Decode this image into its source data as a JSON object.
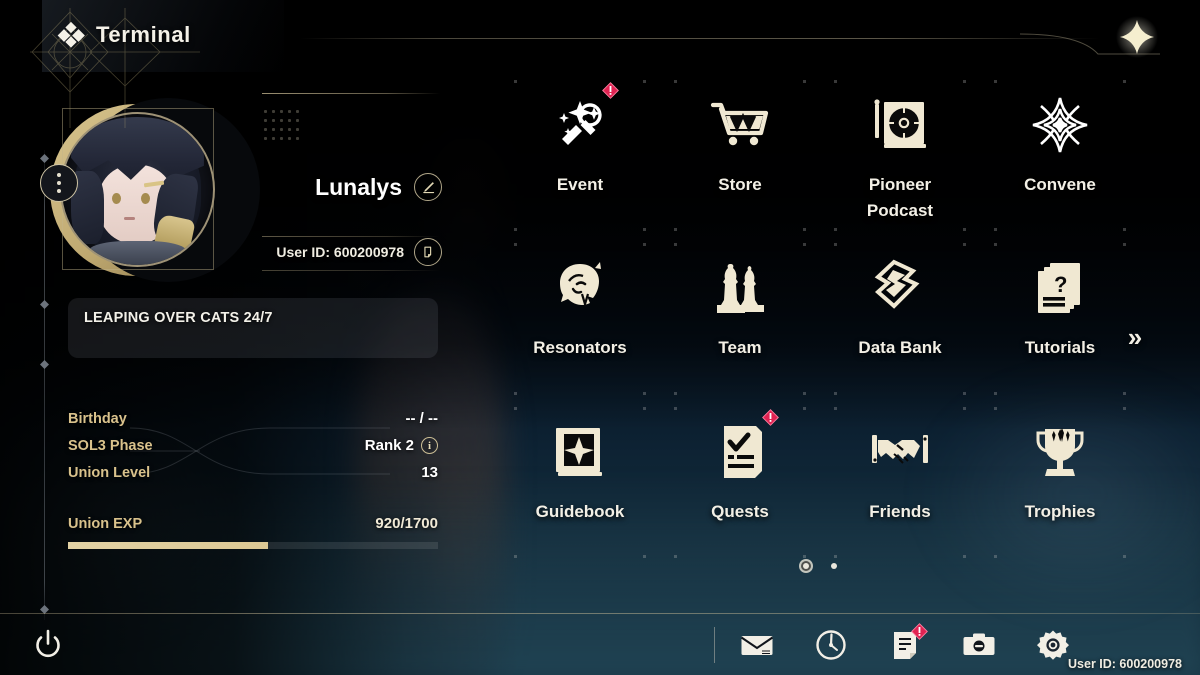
{
  "header": {
    "title": "Terminal",
    "icon": "diamond-cluster-icon",
    "close_label": "×"
  },
  "profile": {
    "avatar_alt": "Lunalys avatar",
    "name": "Lunalys",
    "edit_icon": "pencil-icon",
    "user_id_label": "User ID: 600200978",
    "copy_icon": "copy-icon",
    "signature": "LEAPING OVER CATS 24/7",
    "more_icon": "more-options-icon",
    "stats": [
      {
        "label": "Birthday",
        "value": "-- / --",
        "info": false
      },
      {
        "label": "SOL3 Phase",
        "value": "Rank 2",
        "info": true,
        "info_glyph": "i"
      },
      {
        "label": "Union Level",
        "value": "13",
        "info": false
      }
    ],
    "exp": {
      "label": "Union EXP",
      "value": "920/1700",
      "current": 920,
      "max": 1700,
      "percent": 54
    }
  },
  "menu": {
    "items": [
      {
        "label": "Event",
        "icon": "sparkle-event-icon",
        "badge": true,
        "tone": "white"
      },
      {
        "label": "Store",
        "icon": "shopping-cart-icon",
        "badge": false,
        "tone": "cream"
      },
      {
        "label": "Pioneer\nPodcast",
        "icon": "turntable-icon",
        "badge": false,
        "tone": "cream"
      },
      {
        "label": "Convene",
        "icon": "four-point-star-icon",
        "badge": false,
        "tone": "white"
      },
      {
        "label": "Resonators",
        "icon": "character-head-icon",
        "badge": false,
        "tone": "cream"
      },
      {
        "label": "Team",
        "icon": "chess-pieces-icon",
        "badge": false,
        "tone": "cream"
      },
      {
        "label": "Data Bank",
        "icon": "data-bank-icon",
        "badge": false,
        "tone": "cream"
      },
      {
        "label": "Tutorials",
        "icon": "question-cards-icon",
        "badge": false,
        "tone": "cream"
      },
      {
        "label": "Guidebook",
        "icon": "compass-book-icon",
        "badge": false,
        "tone": "cream"
      },
      {
        "label": "Quests",
        "icon": "checklist-icon",
        "badge": true,
        "tone": "cream"
      },
      {
        "label": "Friends",
        "icon": "handshake-icon",
        "badge": false,
        "tone": "cream"
      },
      {
        "label": "Trophies",
        "icon": "trophy-icon",
        "badge": false,
        "tone": "cream"
      }
    ],
    "next_label": "»",
    "pages": 2,
    "active_page": 1
  },
  "bottom_bar": {
    "power_icon": "power-icon",
    "items": [
      {
        "icon": "mail-icon",
        "name": "mail",
        "badge": false
      },
      {
        "icon": "compass-icon",
        "name": "exploration",
        "badge": false
      },
      {
        "icon": "notice-icon",
        "name": "notice",
        "badge": true
      },
      {
        "icon": "camera-icon",
        "name": "camera",
        "badge": false
      },
      {
        "icon": "gear-icon",
        "name": "settings",
        "badge": false
      }
    ],
    "user_id_label": "User ID: 600200978"
  },
  "colors": {
    "gold": "#d9c28c",
    "cream": "#efe7d0",
    "white": "#ffffff",
    "badge_red": "#e02352",
    "bar_fill": "#ddc894"
  }
}
